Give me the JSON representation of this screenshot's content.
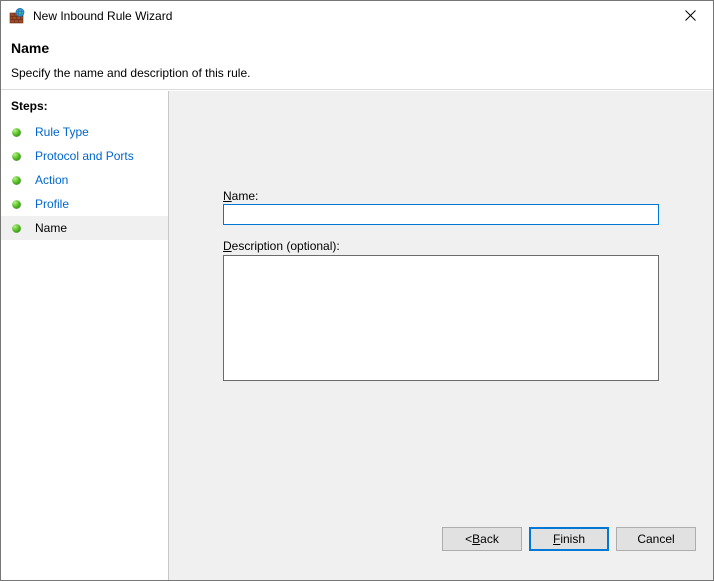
{
  "window": {
    "title": "New Inbound Rule Wizard",
    "icon": "firewall-globe-icon",
    "close_label": "✕"
  },
  "header": {
    "title": "Name",
    "subtitle": "Specify the name and description of this rule."
  },
  "sidebar": {
    "heading": "Steps:",
    "items": [
      {
        "label": "Rule Type",
        "state": "completed",
        "bullet": "green-dot-icon"
      },
      {
        "label": "Protocol and Ports",
        "state": "completed",
        "bullet": "green-dot-icon"
      },
      {
        "label": "Action",
        "state": "completed",
        "bullet": "green-dot-icon"
      },
      {
        "label": "Profile",
        "state": "completed",
        "bullet": "green-dot-icon"
      },
      {
        "label": "Name",
        "state": "current",
        "bullet": "green-dot-icon"
      }
    ]
  },
  "form": {
    "name_field": {
      "label_prefix": "",
      "label_accel": "N",
      "label_suffix": "ame:",
      "value": "",
      "placeholder": ""
    },
    "description_field": {
      "label_prefix": "",
      "label_accel": "D",
      "label_suffix": "escription (optional):",
      "value": "",
      "placeholder": ""
    }
  },
  "buttons": {
    "back": {
      "prefix": "< ",
      "accel": "B",
      "suffix": "ack"
    },
    "finish": {
      "prefix": "",
      "accel": "F",
      "suffix": "inish"
    },
    "cancel": {
      "prefix": "",
      "accel": "",
      "suffix": "Cancel"
    }
  },
  "colors": {
    "accent": "#0078d7",
    "link": "#0066cc",
    "panel": "#f0f0f0",
    "button_face": "#e1e1e1",
    "bullet_green": "#5ec22c"
  }
}
